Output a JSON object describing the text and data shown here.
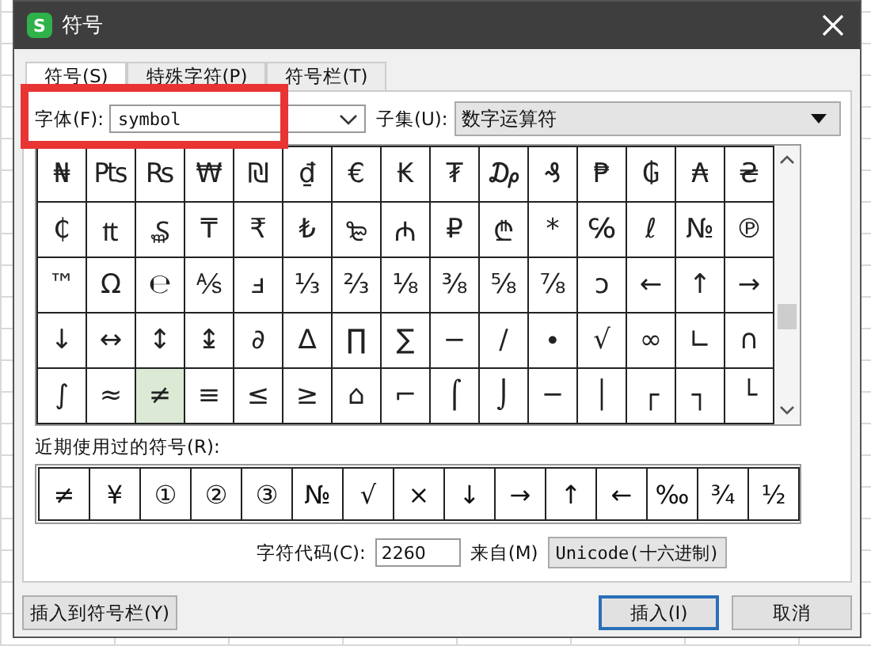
{
  "window": {
    "icon_text": "S",
    "title": "符号"
  },
  "tabs": [
    {
      "label": "符号(S)",
      "selected": true
    },
    {
      "label": "特殊字符(P)",
      "selected": false
    },
    {
      "label": "符号栏(T)",
      "selected": false
    }
  ],
  "font": {
    "label": "字体(F):",
    "value": "symbol",
    "highlighted": true
  },
  "subset": {
    "label": "子集(U):",
    "value": "数字运算符"
  },
  "symbol_grid": [
    [
      {
        "char": "₦",
        "selected": false
      },
      {
        "char": "₧",
        "selected": false
      },
      {
        "char": "₨",
        "selected": false
      },
      {
        "char": "₩",
        "selected": false
      },
      {
        "char": "₪",
        "selected": false
      },
      {
        "char": "₫",
        "selected": false
      },
      {
        "char": "€",
        "selected": false
      },
      {
        "char": "₭",
        "selected": false
      },
      {
        "char": "₮",
        "selected": false
      },
      {
        "char": "₯",
        "selected": false
      },
      {
        "char": "₰",
        "selected": false
      },
      {
        "char": "₱",
        "selected": false
      },
      {
        "char": "₲",
        "selected": false
      },
      {
        "char": "₳",
        "selected": false
      },
      {
        "char": "₴",
        "selected": false
      }
    ],
    [
      {
        "char": "₵",
        "selected": false
      },
      {
        "char": "₶",
        "selected": false
      },
      {
        "char": "₷",
        "selected": false
      },
      {
        "char": "₸",
        "selected": false
      },
      {
        "char": "₹",
        "selected": false
      },
      {
        "char": "₺",
        "selected": false
      },
      {
        "char": "₻",
        "selected": false
      },
      {
        "char": "₼",
        "selected": false
      },
      {
        "char": "₽",
        "selected": false
      },
      {
        "char": "₾",
        "selected": false
      },
      {
        "char": "*",
        "selected": false
      },
      {
        "char": "℅",
        "selected": false
      },
      {
        "char": "ℓ",
        "selected": false
      },
      {
        "char": "№",
        "selected": false
      },
      {
        "char": "℗",
        "selected": false
      }
    ],
    [
      {
        "char": "™",
        "selected": false
      },
      {
        "char": "Ω",
        "selected": false
      },
      {
        "char": "℮",
        "selected": false
      },
      {
        "char": "⅍",
        "selected": false
      },
      {
        "char": "ⅎ",
        "selected": false
      },
      {
        "char": "⅓",
        "selected": false
      },
      {
        "char": "⅔",
        "selected": false
      },
      {
        "char": "⅛",
        "selected": false
      },
      {
        "char": "⅜",
        "selected": false
      },
      {
        "char": "⅝",
        "selected": false
      },
      {
        "char": "⅞",
        "selected": false
      },
      {
        "char": "ↄ",
        "selected": false
      },
      {
        "char": "←",
        "selected": false
      },
      {
        "char": "↑",
        "selected": false
      },
      {
        "char": "→",
        "selected": false
      }
    ],
    [
      {
        "char": "↓",
        "selected": false
      },
      {
        "char": "↔",
        "selected": false
      },
      {
        "char": "↕",
        "selected": false
      },
      {
        "char": "↨",
        "selected": false
      },
      {
        "char": "∂",
        "selected": false
      },
      {
        "char": "∆",
        "selected": false
      },
      {
        "char": "∏",
        "selected": false
      },
      {
        "char": "∑",
        "selected": false
      },
      {
        "char": "−",
        "selected": false
      },
      {
        "char": "∕",
        "selected": false
      },
      {
        "char": "∙",
        "selected": false
      },
      {
        "char": "√",
        "selected": false
      },
      {
        "char": "∞",
        "selected": false
      },
      {
        "char": "∟",
        "selected": false
      },
      {
        "char": "∩",
        "selected": false
      }
    ],
    [
      {
        "char": "∫",
        "selected": false
      },
      {
        "char": "≈",
        "selected": false
      },
      {
        "char": "≠",
        "selected": true
      },
      {
        "char": "≡",
        "selected": false
      },
      {
        "char": "≤",
        "selected": false
      },
      {
        "char": "≥",
        "selected": false
      },
      {
        "char": "⌂",
        "selected": false
      },
      {
        "char": "⌐",
        "selected": false
      },
      {
        "char": "⌠",
        "selected": false
      },
      {
        "char": "⌡",
        "selected": false
      },
      {
        "char": "─",
        "selected": false
      },
      {
        "char": "│",
        "selected": false
      },
      {
        "char": "┌",
        "selected": false
      },
      {
        "char": "┐",
        "selected": false
      },
      {
        "char": "└",
        "selected": false
      }
    ]
  ],
  "recent": {
    "label": "近期使用过的符号(R):",
    "symbols": [
      "≠",
      "¥",
      "①",
      "②",
      "③",
      "№",
      "√",
      "×",
      "↓",
      "→",
      "↑",
      "←",
      "‰",
      "¾",
      "½"
    ]
  },
  "char_code": {
    "label": "字符代码(C):",
    "value": "2260",
    "from_label": "来自(M)",
    "from_value": "Unicode(十六进制)"
  },
  "buttons": {
    "insert_to_bar": "插入到符号栏(Y)",
    "insert": "插入(I)",
    "cancel": "取消"
  }
}
